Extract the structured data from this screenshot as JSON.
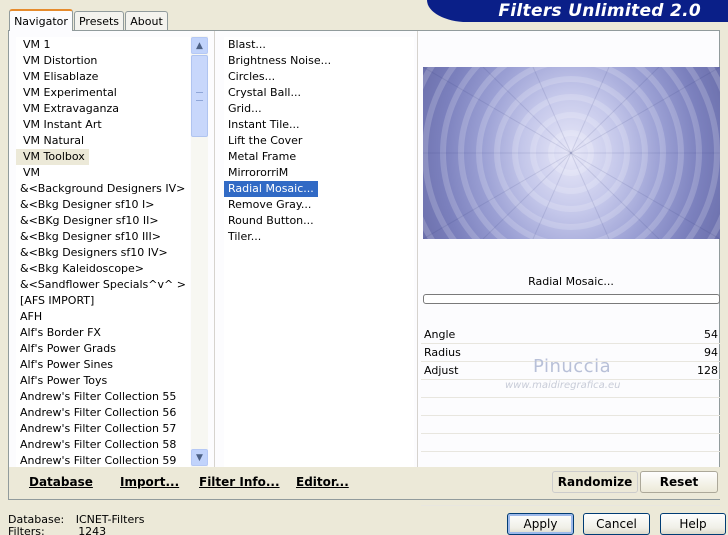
{
  "header": {
    "title": "Filters Unlimited 2.0"
  },
  "tabs": [
    {
      "label": "Navigator"
    },
    {
      "label": "Presets"
    },
    {
      "label": "About"
    }
  ],
  "categories": [
    "VM 1",
    "VM Distortion",
    "VM Elisablaze",
    "VM Experimental",
    "VM Extravaganza",
    "VM Instant Art",
    "VM Natural",
    "VM Toolbox",
    "VM",
    "&<Background Designers IV>",
    "&<Bkg Designer sf10 I>",
    "&<BKg Designer sf10 II>",
    "&<Bkg Designer sf10 III>",
    "&<Bkg Designers sf10 IV>",
    "&<Bkg Kaleidoscope>",
    "&<Sandflower Specials^v^ >",
    "[AFS IMPORT]",
    "AFH",
    "Alf's Border FX",
    "Alf's Power Grads",
    "Alf's Power Sines",
    "Alf's Power Toys",
    "Andrew's Filter Collection 55",
    "Andrew's Filter Collection 56",
    "Andrew's Filter Collection 57",
    "Andrew's Filter Collection 58",
    "Andrew's Filter Collection 59"
  ],
  "selected_category": "VM Toolbox",
  "filters": [
    "Blast...",
    "Brightness Noise...",
    "Circles...",
    "Crystal Ball...",
    "Grid...",
    "Instant Tile...",
    "Lift the Cover",
    "Metal Frame",
    "MirrororriM",
    "Radial Mosaic...",
    "Remove Gray...",
    "Round Button...",
    "Tiler..."
  ],
  "selected_filter": "Radial Mosaic...",
  "filter_title": "Radial Mosaic...",
  "params": [
    {
      "label": "Angle",
      "value": "54"
    },
    {
      "label": "Radius",
      "value": "94"
    },
    {
      "label": "Adjust",
      "value": "128"
    }
  ],
  "watermark": {
    "line1": "Pinuccia",
    "line2": "www.maidiregrafica.eu"
  },
  "bottom_links": {
    "database": "Database",
    "import": "Import...",
    "filter_info": "Filter Info...",
    "editor": "Editor..."
  },
  "buttons": {
    "randomize": "Randomize",
    "reset": "Reset",
    "apply": "Apply",
    "cancel": "Cancel",
    "help": "Help"
  },
  "status": {
    "database_label": "Database:",
    "database_value": "ICNET-Filters",
    "filters_label": "Filters:",
    "filters_value": "1243"
  },
  "colors": {
    "banner": "#0a1f88",
    "selection": "#316ac5",
    "tab_accent": "#e68b2c"
  }
}
